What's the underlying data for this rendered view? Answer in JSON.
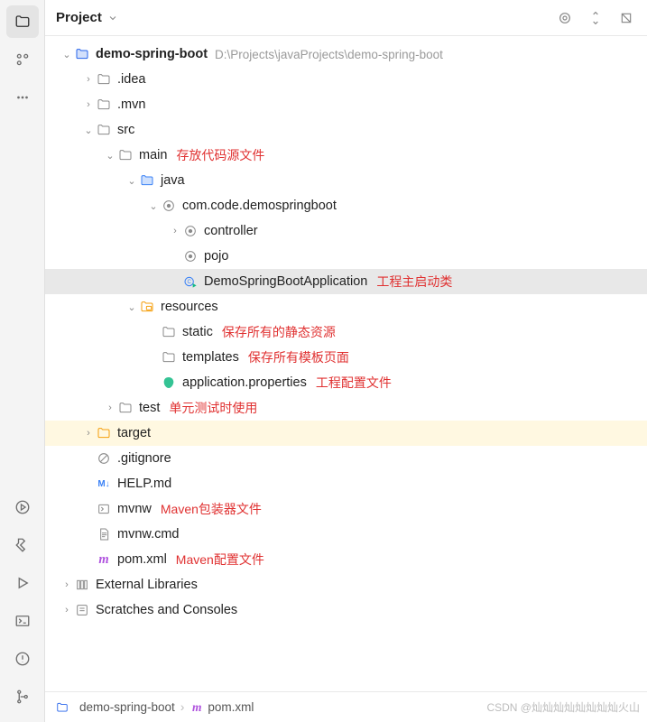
{
  "header": {
    "title": "Project"
  },
  "tree": {
    "root": {
      "name": "demo-spring-boot",
      "path": "D:\\Projects\\javaProjects\\demo-spring-boot"
    },
    "idea": ".idea",
    "mvn": ".mvn",
    "src": "src",
    "main": "main",
    "main_note": "存放代码源文件",
    "java": "java",
    "package": "com.code.demospringboot",
    "controller": "controller",
    "pojo": "pojo",
    "app_class": "DemoSpringBootApplication",
    "app_class_note": "工程主启动类",
    "resources": "resources",
    "static": "static",
    "static_note": "保存所有的静态资源",
    "templates": "templates",
    "templates_note": "保存所有模板页面",
    "appprops": "application.properties",
    "appprops_note": "工程配置文件",
    "test": "test",
    "test_note": "单元测试时使用",
    "target": "target",
    "gitignore": ".gitignore",
    "helpmd": "HELP.md",
    "mvnw": "mvnw",
    "mvnw_note": "Maven包装器文件",
    "mvnwcmd": "mvnw.cmd",
    "pom": "pom.xml",
    "pom_note": "Maven配置文件",
    "extlib": "External Libraries",
    "scratches": "Scratches and Consoles"
  },
  "breadcrumbs": {
    "project": "demo-spring-boot",
    "file": "pom.xml"
  },
  "watermark": "CSDN @灿灿灿灿灿灿灿灿火山"
}
